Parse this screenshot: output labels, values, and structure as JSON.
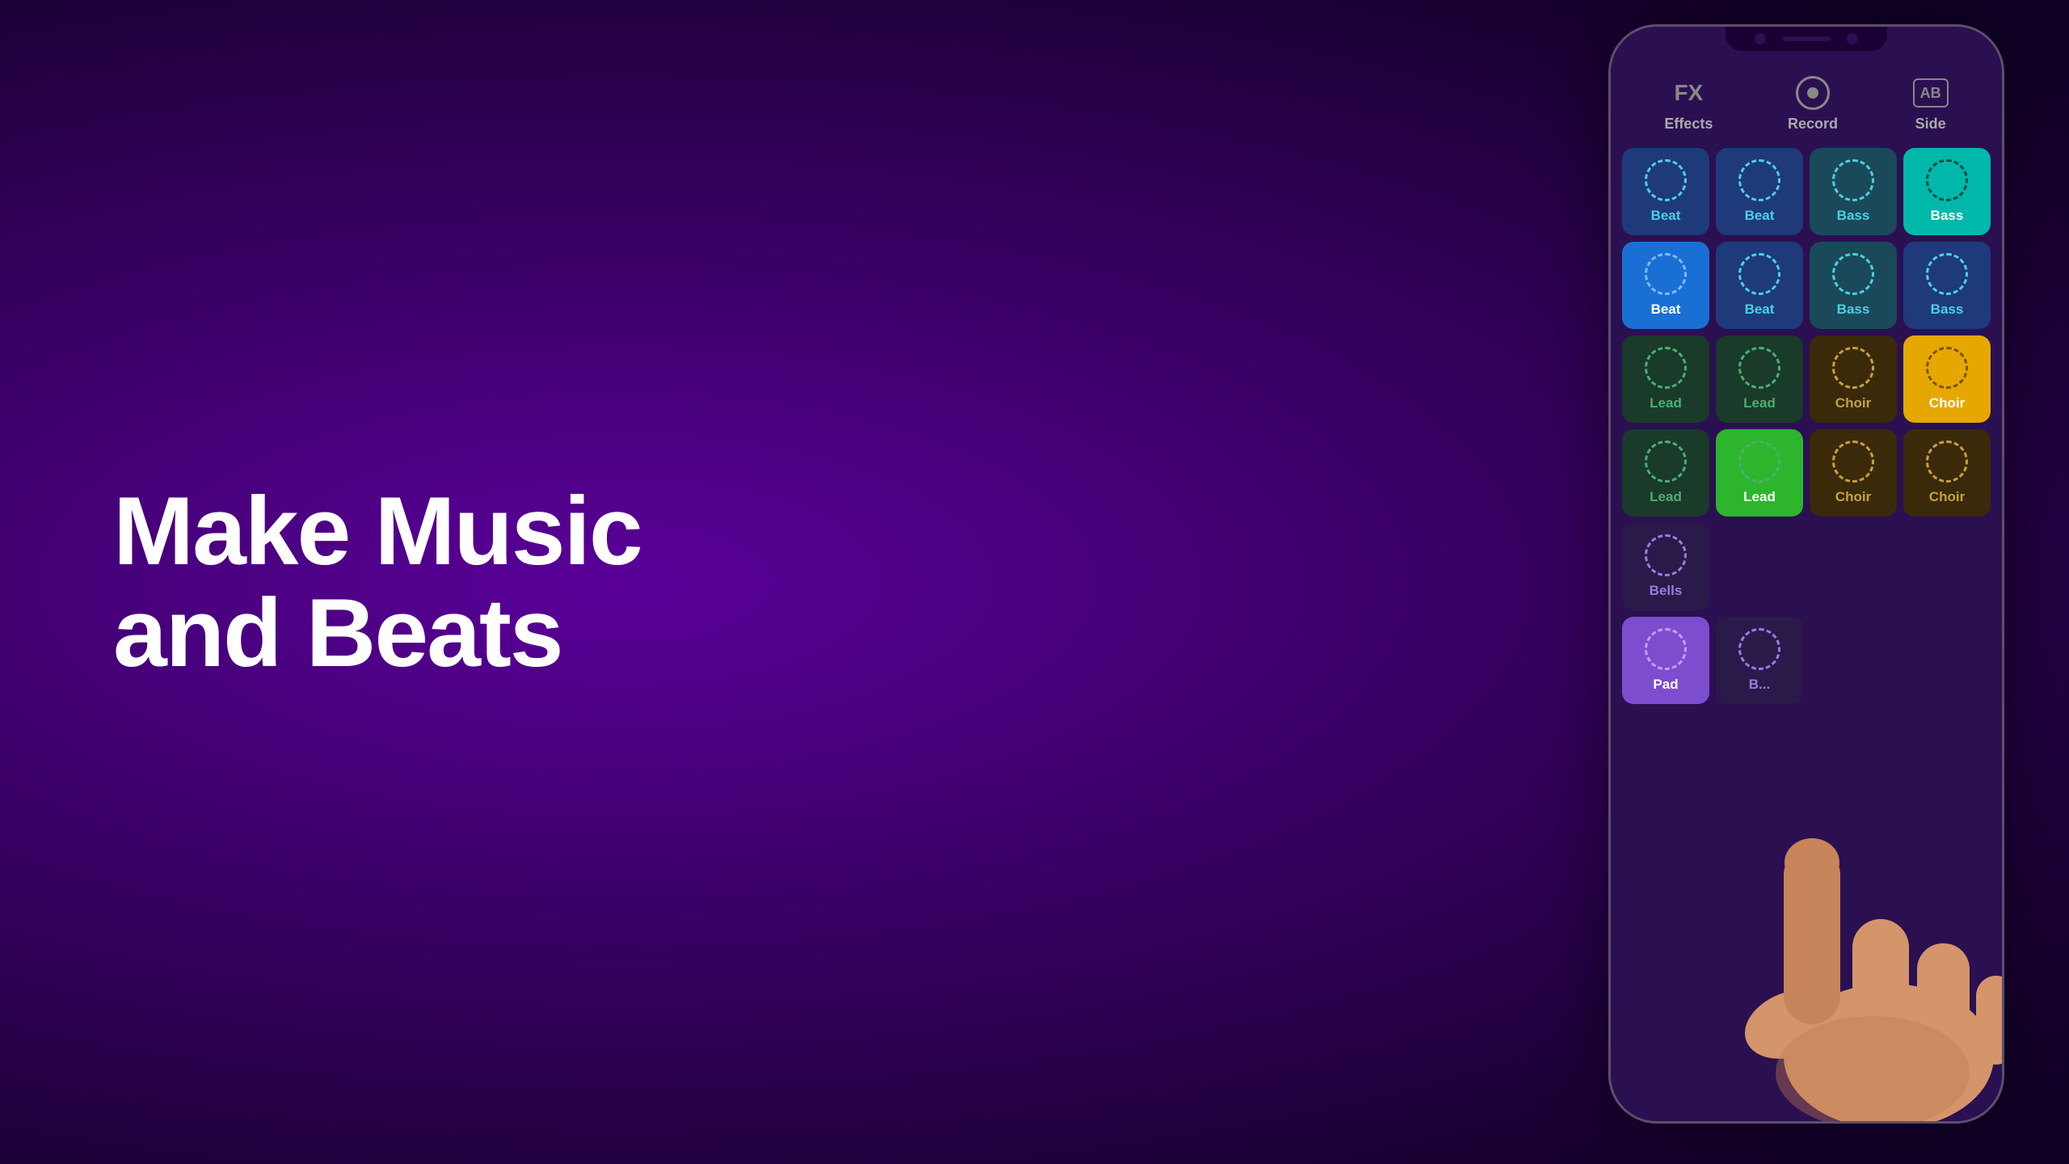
{
  "background": {
    "gradient_start": "#5a0099",
    "gradient_end": "#0d0022"
  },
  "headline": {
    "line1": "Make Music",
    "line2": "and Beats"
  },
  "toolbar": {
    "effects_icon_label": "FX",
    "effects_label": "Effects",
    "record_label": "Record",
    "side_label": "Side"
  },
  "pads": {
    "row1": [
      {
        "label": "Beat",
        "type": "beat",
        "color": "blue-dark",
        "circle": "blue"
      },
      {
        "label": "Beat",
        "type": "beat",
        "color": "blue-dark",
        "circle": "blue"
      },
      {
        "label": "Bass",
        "type": "bass",
        "color": "teal-dark",
        "circle": "blue"
      },
      {
        "label": "Bass",
        "type": "bass",
        "color": "teal-active",
        "circle": "teal-active"
      }
    ],
    "row2": [
      {
        "label": "Beat",
        "type": "beat",
        "color": "blue-bright",
        "circle": "blue-bright"
      },
      {
        "label": "Beat",
        "type": "beat",
        "color": "blue-navy",
        "circle": "blue"
      },
      {
        "label": "Bass",
        "type": "bass",
        "color": "teal-dark",
        "circle": "blue"
      },
      {
        "label": "Bass",
        "type": "bass",
        "color": "blue-navy",
        "circle": "blue"
      }
    ],
    "row3": [
      {
        "label": "Lead",
        "type": "lead",
        "color": "green-dark",
        "circle": "green"
      },
      {
        "label": "Lead",
        "type": "lead",
        "color": "green-dark",
        "circle": "green"
      },
      {
        "label": "Choir",
        "type": "choir",
        "color": "brown-dark",
        "circle": "brown"
      },
      {
        "label": "Choir",
        "type": "choir",
        "color": "yellow-active",
        "circle": "yellow-active"
      }
    ],
    "row4": [
      {
        "label": "Lead",
        "type": "lead",
        "color": "green-dark",
        "circle": "green"
      },
      {
        "label": "Lead",
        "type": "lead",
        "color": "green-bright",
        "circle": "green"
      },
      {
        "label": "Choir",
        "type": "choir",
        "color": "brown-dark",
        "circle": "brown"
      },
      {
        "label": "Choir",
        "type": "choir",
        "color": "brown-dark",
        "circle": "brown"
      }
    ],
    "row5": [
      {
        "label": "Bells",
        "type": "bells",
        "color": "purple-dark",
        "circle": "purple"
      },
      {
        "label": "",
        "type": "hidden",
        "color": "hidden"
      },
      {
        "label": "",
        "type": "hidden",
        "color": "hidden"
      },
      {
        "label": "",
        "type": "hidden",
        "color": "hidden"
      }
    ],
    "row6": [
      {
        "label": "Pad",
        "type": "pad",
        "color": "purple-bright",
        "circle": "purple-bright"
      },
      {
        "label": "B...",
        "type": "partial",
        "color": "purple-dark",
        "circle": "purple"
      },
      {
        "label": "",
        "type": "hidden",
        "color": "hidden"
      },
      {
        "label": "",
        "type": "hidden",
        "color": "hidden"
      }
    ]
  }
}
